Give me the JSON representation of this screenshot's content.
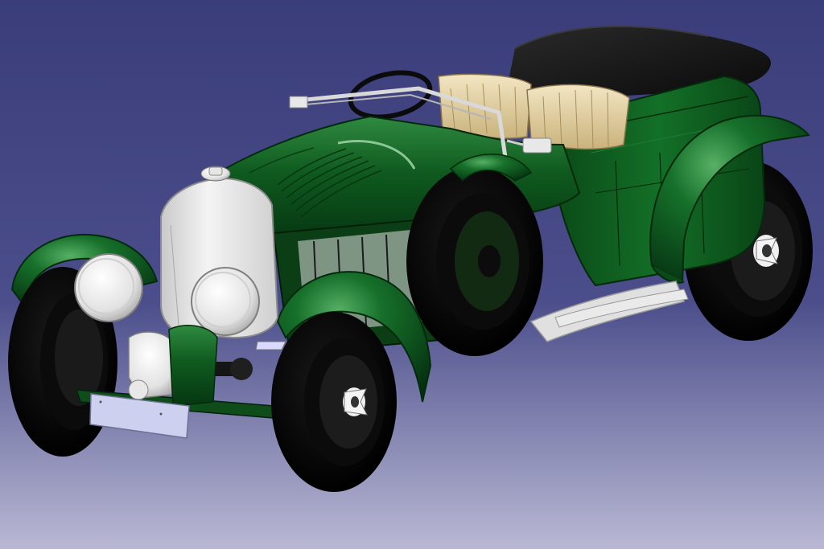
{
  "viewport": {
    "background_top": "#3a3d7a",
    "background_bottom": "#b9b8d4"
  },
  "model": {
    "body_color": "#0f5a1f",
    "body_shadow": "#063611",
    "body_highlight": "#3f9a4f",
    "chrome_color": "#e6e6e6",
    "tire_color": "#050505",
    "seat_color": "#e6d4a4",
    "hood_top_color": "#151515",
    "plate_color": "#cdd0ee"
  }
}
